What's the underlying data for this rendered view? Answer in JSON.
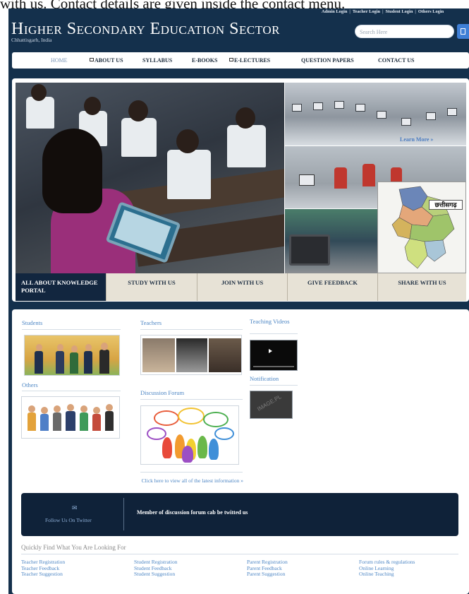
{
  "document": {
    "top_line": "with us. Contact details are given inside the contact menu."
  },
  "header": {
    "top_links": [
      "Admin Login",
      "Teacher Login",
      "Student Login",
      "Others Login"
    ],
    "title": "Higher Secondary Education Sector",
    "subtitle": "Chhattisgarh, India",
    "search_placeholder": "Search Here"
  },
  "nav": {
    "items": [
      {
        "label": "HOME",
        "active": true,
        "icon": false
      },
      {
        "label": "ABOUT US",
        "active": false,
        "icon": true
      },
      {
        "label": "SYLLABUS",
        "active": false,
        "icon": false
      },
      {
        "label": "E-BOOKS",
        "active": false,
        "icon": false
      },
      {
        "label": "E-LECTURES",
        "active": false,
        "icon": true
      },
      {
        "label": "QUESTION PAPERS",
        "active": false,
        "icon": false
      },
      {
        "label": "CONTACT US",
        "active": false,
        "icon": false
      }
    ]
  },
  "hero": {
    "learn_more": "Learn More »",
    "map_label": "छत्तीसगढ़",
    "tabs": [
      "ALL ABOUT KNOWLEDGE PORTAL",
      "STUDY WITH US",
      "JOIN WITH US",
      "GIVE FEEDBACK",
      "SHARE WITH US"
    ]
  },
  "sections": {
    "students": "Students",
    "teachers": "Teachers",
    "teaching_videos": "Teaching Videos",
    "others": "Others",
    "discussion_forum": "Discussion Forum",
    "notification": "Notification",
    "notification_watermark": "IMAGE.PL",
    "more_link": "Click here to view all of the latest information »"
  },
  "banner": {
    "twitter_label": "Follow Us On Twitter",
    "text": "Member of discussion forum cab be twitted us"
  },
  "quick": {
    "title": "Quickly Find What You Are Looking For",
    "columns": [
      [
        "Teacher Registration",
        "Teacher Feedback",
        "Teacher Suggestion"
      ],
      [
        "Student Registration",
        "Student Feedback",
        "Student Suggestion"
      ],
      [
        "Parent Registration",
        "Parent Feedback",
        "Parent Suggestion"
      ],
      [
        "Forum rules & regulations",
        "Online Learning",
        "Online Teaching"
      ]
    ]
  },
  "colors": {
    "frame": "#14304c",
    "accent_link": "#4d86c4",
    "active_tab": "#12263f",
    "tab_bg": "#e7e2d6"
  }
}
